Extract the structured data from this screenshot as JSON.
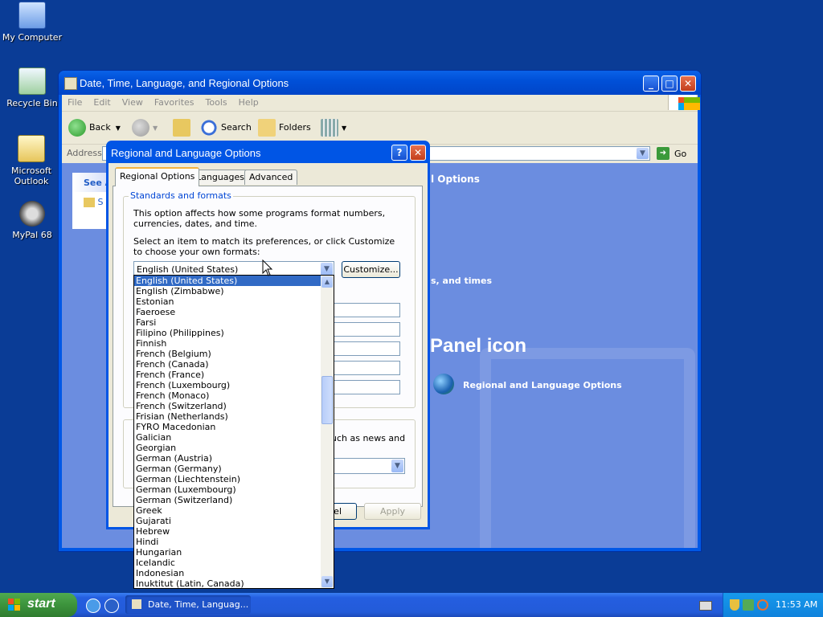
{
  "desktop": {
    "icons": [
      {
        "label": "My Computer"
      },
      {
        "label": "Recycle Bin"
      },
      {
        "label": "Microsoft Outlook"
      },
      {
        "label": "MyPal 68"
      }
    ]
  },
  "explorer": {
    "title": "Date, Time, Language, and Regional Options",
    "menu": [
      "File",
      "Edit",
      "View",
      "Favorites",
      "Tools",
      "Help"
    ],
    "toolbar": {
      "back": "Back",
      "search": "Search",
      "folders": "Folders"
    },
    "address_label": "Address",
    "go_label": "Go",
    "taskpane_title": "See A",
    "taskpane_item": "S",
    "heading_partial": "l Options",
    "task_partial": "s, and times",
    "panel_icon_heading": "Panel icon",
    "cp_icon_label": "Regional and Language Options"
  },
  "dialog": {
    "title": "Regional and Language Options",
    "help_btn": "?",
    "close_btn": "✕",
    "tabs": [
      "Regional Options",
      "Languages",
      "Advanced"
    ],
    "group_title": "Standards and formats",
    "desc": "This option affects how some programs format numbers, currencies, dates, and time.",
    "instruction": "Select an item to match its preferences, or click Customize to choose your own formats:",
    "selected_format": "English (United States)",
    "customize_btn": "Customize...",
    "location_partial": "uch as news and",
    "cancel_partial": "el",
    "apply_btn": "Apply"
  },
  "dropdown": {
    "items": [
      "English (United States)",
      "English (Zimbabwe)",
      "Estonian",
      "Faeroese",
      "Farsi",
      "Filipino (Philippines)",
      "Finnish",
      "French (Belgium)",
      "French (Canada)",
      "French (France)",
      "French (Luxembourg)",
      "French (Monaco)",
      "French (Switzerland)",
      "Frisian (Netherlands)",
      "FYRO Macedonian",
      "Galician",
      "Georgian",
      "German (Austria)",
      "German (Germany)",
      "German (Liechtenstein)",
      "German (Luxembourg)",
      "German (Switzerland)",
      "Greek",
      "Gujarati",
      "Hebrew",
      "Hindi",
      "Hungarian",
      "Icelandic",
      "Indonesian",
      "Inuktitut (Latin, Canada)"
    ],
    "selected_index": 0
  },
  "taskbar": {
    "start_label": "start",
    "task_label": "Date, Time, Languag...",
    "clock": "11:53 AM"
  }
}
